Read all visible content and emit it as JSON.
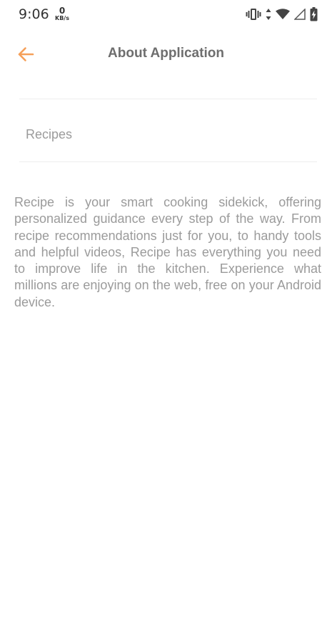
{
  "status_bar": {
    "time": "9:06",
    "net_speed_value": "0",
    "net_speed_unit": "KB/s",
    "icons": [
      "vibrate-icon",
      "data-arrows-icon",
      "wifi-icon",
      "cell-signal-icon",
      "battery-charging-icon"
    ]
  },
  "app_bar": {
    "title": "About Application",
    "back_icon": "arrow-left-icon",
    "accent_color": "#f5a05a"
  },
  "app_info": {
    "name": "Recipes"
  },
  "description": "Recipe is your smart cooking sidekick, offering personalized guidance every step of the way. From recipe recommendations just for you, to handy tools and helpful videos, Recipe has everything you need to improve life in the kitchen. Experience what millions are enjoying on the web, free on your Android device."
}
